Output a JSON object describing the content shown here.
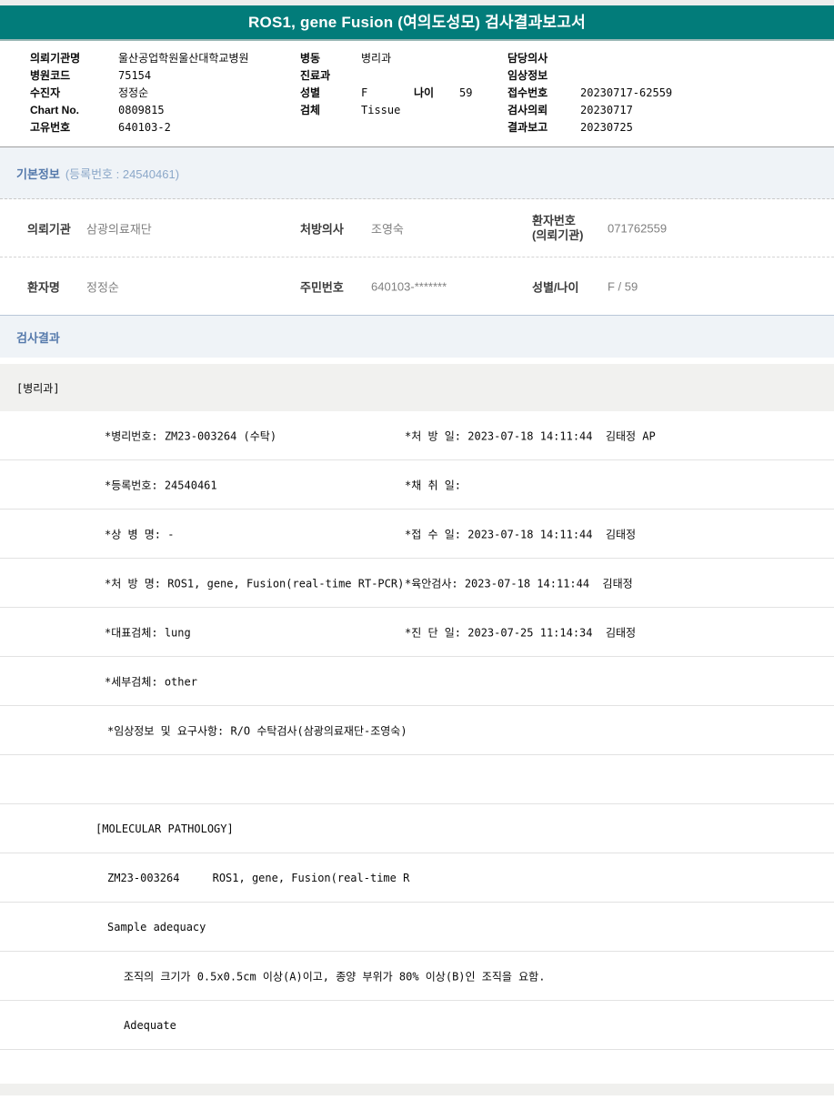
{
  "title": "ROS1, gene Fusion (여의도성모) 검사결과보고서",
  "patient_header": {
    "left": [
      {
        "label": "의뢰기관명",
        "value": "울산공업학원울산대학교병원"
      },
      {
        "label": "병원코드",
        "value": "75154"
      },
      {
        "label": "수진자",
        "value": "정정순"
      },
      {
        "label": "Chart No.",
        "value": "0809815"
      },
      {
        "label": "고유번호",
        "value": "640103-2"
      }
    ],
    "middle": [
      {
        "label": "병동",
        "value": "병리과"
      },
      {
        "label": "진료과",
        "value": ""
      },
      {
        "label": "성별",
        "value": "F",
        "label2": "나이",
        "value2": "59"
      },
      {
        "label": "검체",
        "value": "Tissue"
      }
    ],
    "right": [
      {
        "label": "담당의사",
        "value": ""
      },
      {
        "label": "임상정보",
        "value": ""
      },
      {
        "label": "접수번호",
        "value": "20230717-62559"
      },
      {
        "label": "검사의뢰",
        "value": "20230717"
      },
      {
        "label": "결과보고",
        "value": "20230725"
      }
    ]
  },
  "basic_info": {
    "heading": "기본정보",
    "heading_suffix": "(등록번호 : 24540461)",
    "row1": {
      "label1": "의뢰기관",
      "value1": "삼광의료재단",
      "label2": "처방의사",
      "value2": "조영숙",
      "label3a": "환자번호",
      "label3b": "(의뢰기관)",
      "value3": "071762559"
    },
    "row2": {
      "label1": "환자명",
      "value1": "정정순",
      "label2": "주민번호",
      "value2": "640103-*******",
      "label3a": "성별/나이",
      "label3b": "",
      "value3": "F / 59"
    }
  },
  "results": {
    "heading": "검사결과",
    "dept": "[병리과]",
    "rows": [
      {
        "left": "*병리번호: ZM23-003264 (수탁)",
        "right": "*처 방 일: 2023-07-18 14:11:44  김태정 AP"
      },
      {
        "left": "*등록번호: 24540461",
        "right": "*채 취 일:"
      },
      {
        "left": "*상 병 명: -",
        "right": "*접 수 일: 2023-07-18 14:11:44  김태정"
      },
      {
        "left": "*처 방 명: ROS1, gene, Fusion(real-time RT-PCR)",
        "right": "*육안검사: 2023-07-18 14:11:44  김태정"
      },
      {
        "left": "*대표검체: lung",
        "right": "*진 단 일: 2023-07-25 11:14:34  김태정"
      },
      {
        "left": "*세부검체: other",
        "right": ""
      },
      {
        "left": "*임상정보 및 요구사항: R/O 수탁검사(삼광의료재단-조영숙)",
        "right": ""
      },
      {
        "left": "",
        "right": ""
      },
      {
        "left": "[MOLECULAR PATHOLOGY]",
        "right": ""
      },
      {
        "left": "ZM23-003264     ROS1, gene, Fusion(real-time R",
        "right": ""
      },
      {
        "left": "Sample adequacy",
        "right": ""
      },
      {
        "left": "조직의 크기가 0.5x0.5cm 이상(A)이고, 종양 부위가 80% 이상(B)인 조직을 요함.",
        "right": ""
      },
      {
        "left": "Adequate",
        "right": ""
      },
      {
        "left": "",
        "right": ""
      }
    ]
  },
  "colors": {
    "teal_header": "#027c7a",
    "section_text": "#5579ab",
    "section_text_light": "#8ca8c9",
    "section_bg": "#eff3f7",
    "dept_row_bg": "#f1f1ef",
    "row_border": "#e2e2e2"
  }
}
